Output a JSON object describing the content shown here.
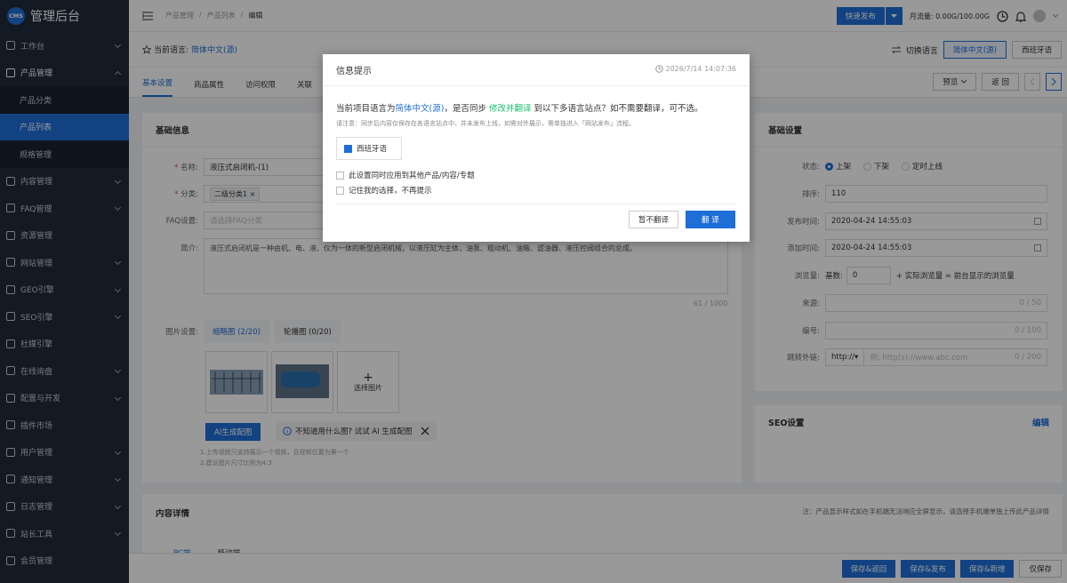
{
  "sidebar": {
    "logo_badge": "CMS",
    "logo_title": "管理后台",
    "items": [
      {
        "label": "工作台"
      },
      {
        "label": "产品管理"
      },
      {
        "label": "产品分类"
      },
      {
        "label": "产品列表"
      },
      {
        "label": "规格管理"
      },
      {
        "label": "内容管理"
      },
      {
        "label": "FAQ管理"
      },
      {
        "label": "资源管理"
      },
      {
        "label": "网站管理"
      },
      {
        "label": "GEO引擎"
      },
      {
        "label": "SEO引擎"
      },
      {
        "label": "社媒引擎"
      },
      {
        "label": "在线询盘"
      },
      {
        "label": "配置与开发"
      },
      {
        "label": "插件市场"
      },
      {
        "label": "用户管理"
      },
      {
        "label": "通知管理"
      },
      {
        "label": "日志管理"
      },
      {
        "label": "站长工具"
      },
      {
        "label": "会员管理"
      }
    ]
  },
  "topbar": {
    "crumb1": "产品管理",
    "crumb2": "产品列表",
    "crumb3": "编辑",
    "sep": "/",
    "quick_publish": "快速发布",
    "traffic": "月流量: 0.00G/100.00G"
  },
  "langbar": {
    "label": "当前语言:",
    "value": "简体中文(源)",
    "switch": "切换语言",
    "lang1": "简体中文(源)",
    "lang2": "西班牙语"
  },
  "tabs": [
    "基本设置",
    "商品属性",
    "访问权限",
    "关联"
  ],
  "tools": {
    "preview": "预览",
    "back": "返 回"
  },
  "basic": {
    "title": "基础信息",
    "name_label": "名称:",
    "name_value": "液压式启闭机-(1)",
    "cat_label": "分类:",
    "cat_tag": "二级分类1",
    "faq_label": "FAQ设置:",
    "faq_ph": "请选择FAQ分类",
    "intro_label": "简介:",
    "intro_value": "液压式启闭机是一种由机、电、液、仪为一体的新型启闭机械，以液压缸为主体，油泵、粗动机、油箱、滤油器、液压控阀组合的总成。",
    "intro_count": "61 / 1000",
    "img_label": "图片设置:",
    "img_tab1": "缩略图 (2/20)",
    "img_tab2": "轮播图 (0/20)",
    "select_img": "选择图片",
    "ai_btn": "AI生成配图",
    "ai_hint": "不知道用什么图? 试试 AI 生成配图",
    "note1": "1.上传视频只支持展示一个视频，且视频位置为第一个",
    "note2": "2.建议图片尺寸比例为4:3"
  },
  "settings": {
    "title": "基础设置",
    "status_label": "状态:",
    "status_opts": [
      "上架",
      "下架",
      "定时上线"
    ],
    "sort_label": "排序:",
    "sort_value": "110",
    "pub_label": "发布时间:",
    "pub_value": "2020-04-24 14:55:03",
    "add_label": "添加时间:",
    "add_value": "2020-04-24 14:55:03",
    "views_label": "浏览量:",
    "views_base": "基数:",
    "views_value": "0",
    "views_hint": "+ 实际浏览量 = 前台显示的浏览量",
    "source_label": "来源:",
    "source_count": "0 / 50",
    "code_label": "编号:",
    "code_count": "0 / 100",
    "link_label": "跳转外链:",
    "link_proto": "http://",
    "link_ph": "例: http(s)://www.abc.com",
    "link_count": "0 / 200",
    "seo_title": "SEO设置",
    "seo_edit": "编辑"
  },
  "content": {
    "title": "内容详情",
    "note": "注：产品显示样式如在手机端无法响应全屏显示，请选择手机端单独上传此产品详情",
    "tab1": "PC端",
    "tab2": "移动端"
  },
  "bottom": {
    "save_back": "保存&返回",
    "save_publish": "保存&发布",
    "save_new": "保存&新增",
    "save_only": "仅保存"
  },
  "dialog": {
    "title": "信息提示",
    "time": "2026/7/14 14:07:36",
    "msg_a": "当前项目语言为",
    "msg_lang": "简体中文(源)",
    "msg_b": "，是否同步",
    "msg_act": "修改并翻译",
    "msg_c": "到以下多语言站点？如不需要翻译，可不选。",
    "note": "请注意：同步后内容仅保存在各语言站点中，并未发布上线，如需对外展示，需单独进入「网站发布」流程。",
    "option_lang": "西班牙语",
    "apply_all": "此设置同时应用到其他产品/内容/专题",
    "remember": "记住我的选择，不再提示",
    "skip": "暂不翻译",
    "translate": "翻 译"
  },
  "colors": {
    "accent": "#1e6ed8",
    "sidebar_bg": "#222c3c",
    "green": "#19be6b"
  }
}
